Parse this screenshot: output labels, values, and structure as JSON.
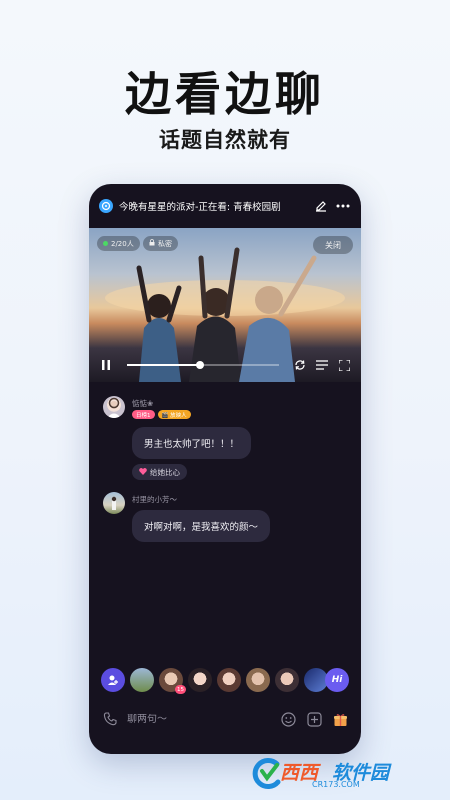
{
  "promo": {
    "headline": "边看边聊",
    "subheadline": "话题自然就有"
  },
  "room": {
    "title": "今晚有星星的派对-正在看: 青春校园剧",
    "edit_icon": "edit-icon",
    "more_icon": "more-icon"
  },
  "video": {
    "viewers": "2/20人",
    "privacy": "私密",
    "close_label": "关闭",
    "progress": 0.48
  },
  "chat": {
    "messages": [
      {
        "sender": "惦惦❀",
        "badges": [
          "日榜1",
          "🎬 放映人"
        ],
        "text": "男主也太帅了吧！！！",
        "reaction": "给她比心"
      },
      {
        "sender": "村里的小芳～",
        "text": "对啊对啊，是我喜欢的颜～"
      }
    ]
  },
  "avatar_row": {
    "levels": [
      "15"
    ],
    "hi_label": "Hi"
  },
  "input": {
    "placeholder": "聊两句～"
  },
  "watermark": {
    "brand_a": "西西",
    "brand_b": "软件园",
    "url": "CR173.COM"
  },
  "colors": {
    "phone_bg": "#16121f",
    "bubble_bg": "#2d2a3e",
    "accent": "#5b4de0"
  }
}
